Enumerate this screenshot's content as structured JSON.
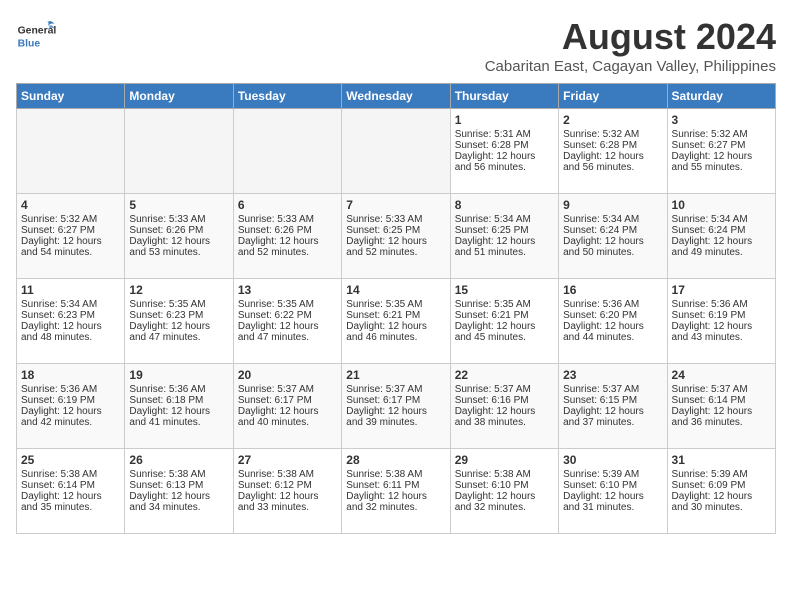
{
  "logo": {
    "line1": "General",
    "line2": "Blue"
  },
  "title": "August 2024",
  "location": "Cabaritan East, Cagayan Valley, Philippines",
  "days_of_week": [
    "Sunday",
    "Monday",
    "Tuesday",
    "Wednesday",
    "Thursday",
    "Friday",
    "Saturday"
  ],
  "weeks": [
    [
      {
        "day": "",
        "empty": true
      },
      {
        "day": "",
        "empty": true
      },
      {
        "day": "",
        "empty": true
      },
      {
        "day": "",
        "empty": true
      },
      {
        "day": "1",
        "sunrise": "Sunrise: 5:31 AM",
        "sunset": "Sunset: 6:28 PM",
        "daylight": "Daylight: 12 hours and 56 minutes."
      },
      {
        "day": "2",
        "sunrise": "Sunrise: 5:32 AM",
        "sunset": "Sunset: 6:28 PM",
        "daylight": "Daylight: 12 hours and 56 minutes."
      },
      {
        "day": "3",
        "sunrise": "Sunrise: 5:32 AM",
        "sunset": "Sunset: 6:27 PM",
        "daylight": "Daylight: 12 hours and 55 minutes."
      }
    ],
    [
      {
        "day": "4",
        "sunrise": "Sunrise: 5:32 AM",
        "sunset": "Sunset: 6:27 PM",
        "daylight": "Daylight: 12 hours and 54 minutes."
      },
      {
        "day": "5",
        "sunrise": "Sunrise: 5:33 AM",
        "sunset": "Sunset: 6:26 PM",
        "daylight": "Daylight: 12 hours and 53 minutes."
      },
      {
        "day": "6",
        "sunrise": "Sunrise: 5:33 AM",
        "sunset": "Sunset: 6:26 PM",
        "daylight": "Daylight: 12 hours and 52 minutes."
      },
      {
        "day": "7",
        "sunrise": "Sunrise: 5:33 AM",
        "sunset": "Sunset: 6:25 PM",
        "daylight": "Daylight: 12 hours and 52 minutes."
      },
      {
        "day": "8",
        "sunrise": "Sunrise: 5:34 AM",
        "sunset": "Sunset: 6:25 PM",
        "daylight": "Daylight: 12 hours and 51 minutes."
      },
      {
        "day": "9",
        "sunrise": "Sunrise: 5:34 AM",
        "sunset": "Sunset: 6:24 PM",
        "daylight": "Daylight: 12 hours and 50 minutes."
      },
      {
        "day": "10",
        "sunrise": "Sunrise: 5:34 AM",
        "sunset": "Sunset: 6:24 PM",
        "daylight": "Daylight: 12 hours and 49 minutes."
      }
    ],
    [
      {
        "day": "11",
        "sunrise": "Sunrise: 5:34 AM",
        "sunset": "Sunset: 6:23 PM",
        "daylight": "Daylight: 12 hours and 48 minutes."
      },
      {
        "day": "12",
        "sunrise": "Sunrise: 5:35 AM",
        "sunset": "Sunset: 6:23 PM",
        "daylight": "Daylight: 12 hours and 47 minutes."
      },
      {
        "day": "13",
        "sunrise": "Sunrise: 5:35 AM",
        "sunset": "Sunset: 6:22 PM",
        "daylight": "Daylight: 12 hours and 47 minutes."
      },
      {
        "day": "14",
        "sunrise": "Sunrise: 5:35 AM",
        "sunset": "Sunset: 6:21 PM",
        "daylight": "Daylight: 12 hours and 46 minutes."
      },
      {
        "day": "15",
        "sunrise": "Sunrise: 5:35 AM",
        "sunset": "Sunset: 6:21 PM",
        "daylight": "Daylight: 12 hours and 45 minutes."
      },
      {
        "day": "16",
        "sunrise": "Sunrise: 5:36 AM",
        "sunset": "Sunset: 6:20 PM",
        "daylight": "Daylight: 12 hours and 44 minutes."
      },
      {
        "day": "17",
        "sunrise": "Sunrise: 5:36 AM",
        "sunset": "Sunset: 6:19 PM",
        "daylight": "Daylight: 12 hours and 43 minutes."
      }
    ],
    [
      {
        "day": "18",
        "sunrise": "Sunrise: 5:36 AM",
        "sunset": "Sunset: 6:19 PM",
        "daylight": "Daylight: 12 hours and 42 minutes."
      },
      {
        "day": "19",
        "sunrise": "Sunrise: 5:36 AM",
        "sunset": "Sunset: 6:18 PM",
        "daylight": "Daylight: 12 hours and 41 minutes."
      },
      {
        "day": "20",
        "sunrise": "Sunrise: 5:37 AM",
        "sunset": "Sunset: 6:17 PM",
        "daylight": "Daylight: 12 hours and 40 minutes."
      },
      {
        "day": "21",
        "sunrise": "Sunrise: 5:37 AM",
        "sunset": "Sunset: 6:17 PM",
        "daylight": "Daylight: 12 hours and 39 minutes."
      },
      {
        "day": "22",
        "sunrise": "Sunrise: 5:37 AM",
        "sunset": "Sunset: 6:16 PM",
        "daylight": "Daylight: 12 hours and 38 minutes."
      },
      {
        "day": "23",
        "sunrise": "Sunrise: 5:37 AM",
        "sunset": "Sunset: 6:15 PM",
        "daylight": "Daylight: 12 hours and 37 minutes."
      },
      {
        "day": "24",
        "sunrise": "Sunrise: 5:37 AM",
        "sunset": "Sunset: 6:14 PM",
        "daylight": "Daylight: 12 hours and 36 minutes."
      }
    ],
    [
      {
        "day": "25",
        "sunrise": "Sunrise: 5:38 AM",
        "sunset": "Sunset: 6:14 PM",
        "daylight": "Daylight: 12 hours and 35 minutes."
      },
      {
        "day": "26",
        "sunrise": "Sunrise: 5:38 AM",
        "sunset": "Sunset: 6:13 PM",
        "daylight": "Daylight: 12 hours and 34 minutes."
      },
      {
        "day": "27",
        "sunrise": "Sunrise: 5:38 AM",
        "sunset": "Sunset: 6:12 PM",
        "daylight": "Daylight: 12 hours and 33 minutes."
      },
      {
        "day": "28",
        "sunrise": "Sunrise: 5:38 AM",
        "sunset": "Sunset: 6:11 PM",
        "daylight": "Daylight: 12 hours and 32 minutes."
      },
      {
        "day": "29",
        "sunrise": "Sunrise: 5:38 AM",
        "sunset": "Sunset: 6:10 PM",
        "daylight": "Daylight: 12 hours and 32 minutes."
      },
      {
        "day": "30",
        "sunrise": "Sunrise: 5:39 AM",
        "sunset": "Sunset: 6:10 PM",
        "daylight": "Daylight: 12 hours and 31 minutes."
      },
      {
        "day": "31",
        "sunrise": "Sunrise: 5:39 AM",
        "sunset": "Sunset: 6:09 PM",
        "daylight": "Daylight: 12 hours and 30 minutes."
      }
    ]
  ]
}
